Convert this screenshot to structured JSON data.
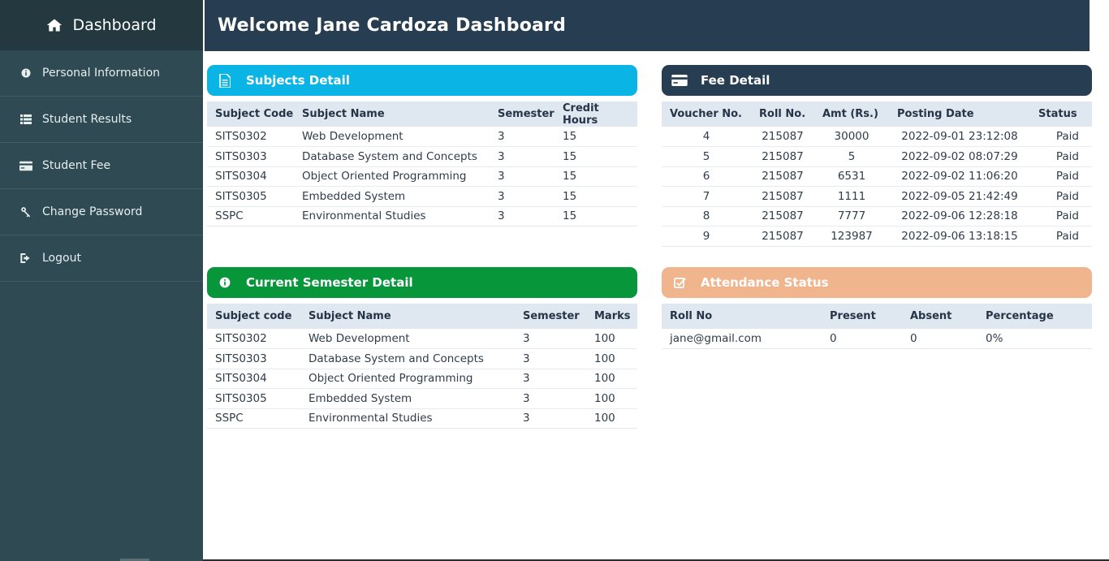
{
  "sidebar": {
    "brand": "Dashboard",
    "items": [
      {
        "label": "Personal Information",
        "icon": "info-icon"
      },
      {
        "label": "Student Results",
        "icon": "list-icon"
      },
      {
        "label": "Student Fee",
        "icon": "credit-card-icon"
      },
      {
        "label": "Change Password",
        "icon": "key-icon"
      },
      {
        "label": "Logout",
        "icon": "logout-icon"
      }
    ]
  },
  "header": {
    "title": "Welcome Jane Cardoza Dashboard"
  },
  "subjects": {
    "title": "Subjects Detail",
    "columns": [
      "Subject Code",
      "Subject Name",
      "Semester",
      "Credit Hours"
    ],
    "rows": [
      [
        "SITS0302",
        "Web Development",
        "3",
        "15"
      ],
      [
        "SITS0303",
        "Database System and Concepts",
        "3",
        "15"
      ],
      [
        "SITS0304",
        "Object Oriented Programming",
        "3",
        "15"
      ],
      [
        "SITS0305",
        "Embedded System",
        "3",
        "15"
      ],
      [
        "SSPC",
        "Environmental Studies",
        "3",
        "15"
      ]
    ]
  },
  "fee": {
    "title": "Fee Detail",
    "columns": [
      "Voucher No.",
      "Roll No.",
      "Amt (Rs.)",
      "Posting Date",
      "Status"
    ],
    "rows": [
      [
        "4",
        "215087",
        "30000",
        "2022-09-01 23:12:08",
        "Paid"
      ],
      [
        "5",
        "215087",
        "5",
        "2022-09-02 08:07:29",
        "Paid"
      ],
      [
        "6",
        "215087",
        "6531",
        "2022-09-02 11:06:20",
        "Paid"
      ],
      [
        "7",
        "215087",
        "1111",
        "2022-09-05 21:42:49",
        "Paid"
      ],
      [
        "8",
        "215087",
        "7777",
        "2022-09-06 12:28:18",
        "Paid"
      ],
      [
        "9",
        "215087",
        "123987",
        "2022-09-06 13:18:15",
        "Paid"
      ]
    ]
  },
  "semester": {
    "title": "Current Semester Detail",
    "columns": [
      "Subject code",
      "Subject Name",
      "Semester",
      "Marks"
    ],
    "rows": [
      [
        "SITS0302",
        "Web Development",
        "3",
        "100"
      ],
      [
        "SITS0303",
        "Database System and Concepts",
        "3",
        "100"
      ],
      [
        "SITS0304",
        "Object Oriented Programming",
        "3",
        "100"
      ],
      [
        "SITS0305",
        "Embedded System",
        "3",
        "100"
      ],
      [
        "SSPC",
        "Environmental Studies",
        "3",
        "100"
      ]
    ]
  },
  "attendance": {
    "title": "Attendance Status",
    "columns": [
      "Roll No",
      "Present",
      "Absent",
      "Percentage"
    ],
    "rows": [
      [
        "jane@gmail.com",
        "0",
        "0",
        "0%"
      ]
    ]
  },
  "colors": {
    "sidebar": "#2f4a53",
    "header": "#263d52",
    "subjects_head": "#0ab5e6",
    "semester_head": "#07963a",
    "attendance_head": "#f1b58e"
  }
}
